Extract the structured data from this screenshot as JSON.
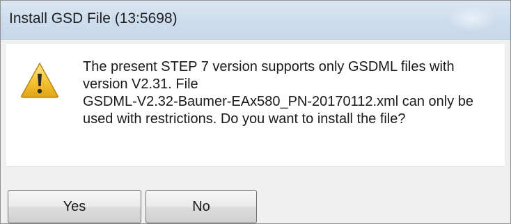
{
  "window": {
    "title": "Install GSD File (13:5698)"
  },
  "dialog": {
    "icon": "warning-icon",
    "message_lines": [
      "The present STEP 7 version supports only GSDML files with",
      "version V2.31. File",
      "GSDML-V2.32-Baumer-EAx580_PN-20170112.xml can only be",
      "used with restrictions. Do you want to install the file?"
    ]
  },
  "buttons": {
    "yes_label": "Yes",
    "no_label": "No"
  },
  "colors": {
    "titlebar": "#cfdeee",
    "warning_fill": "#f2c230",
    "warning_mark": "#2a2a2a"
  }
}
